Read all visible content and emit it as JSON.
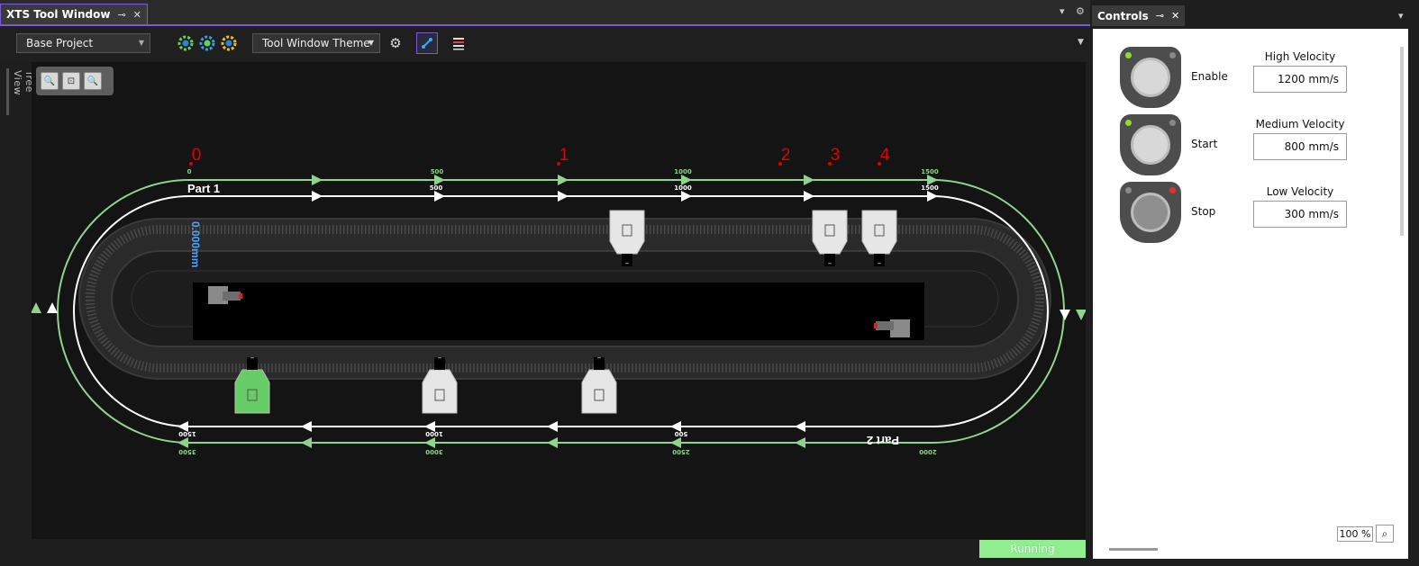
{
  "left_window": {
    "tab_title": "XTS Tool Window",
    "pin_glyph": "⊸",
    "close_glyph": "✕"
  },
  "toolbar": {
    "project_select": "Base Project",
    "theme_select": "Tool Window Theme"
  },
  "tree_view_label": "Tree View",
  "track": {
    "position_markers": [
      "0",
      "1",
      "2",
      "3",
      "4"
    ],
    "top_inner_ticks": [
      "0",
      "500",
      "1000",
      "1500"
    ],
    "top_outer_ticks": [
      "500",
      "1000",
      "1500"
    ],
    "bottom_inner_ticks": [
      "1500",
      "1000",
      "500"
    ],
    "bottom_outer_ticks": [
      "3500",
      "3000",
      "2500",
      "2000"
    ],
    "part1_label": "Part 1",
    "part2_label": "Part 2",
    "position_readout": "0.000mm",
    "mover_dash": "–",
    "colors": {
      "outer_track": "#8fd38f",
      "inner_track": "#ffffff",
      "marker": "#e00000",
      "readout": "#4da3ff",
      "highlight_mover": "#66cc66"
    }
  },
  "status": {
    "text": "Running",
    "color": "#90ee90"
  },
  "controls_window": {
    "tab_title": "Controls",
    "rows": [
      {
        "label": "Enable",
        "velocity_title": "High Velocity",
        "velocity_value": "1200 mm/s",
        "led_left": "#8fdd2a",
        "led_right": "#888888",
        "knob": "#d8d8d8"
      },
      {
        "label": "Start",
        "velocity_title": "Medium Velocity",
        "velocity_value": "800 mm/s",
        "led_left": "#8fdd2a",
        "led_right": "#888888",
        "knob": "#d8d8d8"
      },
      {
        "label": "Stop",
        "velocity_title": "Low Velocity",
        "velocity_value": "300 mm/s",
        "led_left": "#888888",
        "led_right": "#e03030",
        "knob": "#8f8f8f"
      }
    ],
    "zoom_level": "100 %"
  },
  "icons": {
    "zoom_in": "zoom-in-icon",
    "zoom_fit": "zoom-fit-icon",
    "zoom_out": "zoom-out-icon",
    "settings": "gear-icon",
    "connect": "connect-icon",
    "layers": "list-icon"
  }
}
